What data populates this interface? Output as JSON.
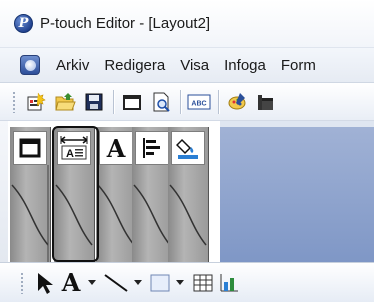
{
  "app": {
    "title": "P-touch Editor - [Layout2]",
    "icon_glyph": "P"
  },
  "menubar": {
    "items": [
      "Arkiv",
      "Redigera",
      "Visa",
      "Infoga",
      "Form"
    ]
  },
  "toolbar": {
    "icons": [
      "new-layout-icon",
      "open-folder-icon",
      "save-icon",
      "print-icon",
      "print-preview-icon",
      "abc-text-icon",
      "paint-icon",
      "bucket-icon"
    ],
    "abc_label": "ABC"
  },
  "side_tabs": {
    "icons": [
      "window-icon",
      "text-width-icon",
      "font-a-icon",
      "align-left-icon",
      "fill-color-icon"
    ],
    "font_glyph": "A"
  },
  "drawbar": {
    "tools": [
      "select-arrow-icon",
      "text-tool-icon",
      "line-tool-icon",
      "rectangle-tool-icon",
      "table-tool-icon",
      "chart-tool-icon"
    ],
    "text_glyph": "A"
  },
  "colors": {
    "canvas": "#8ca0cc",
    "highlight_border": "#111111",
    "titlebar": "#f4f7fb"
  }
}
